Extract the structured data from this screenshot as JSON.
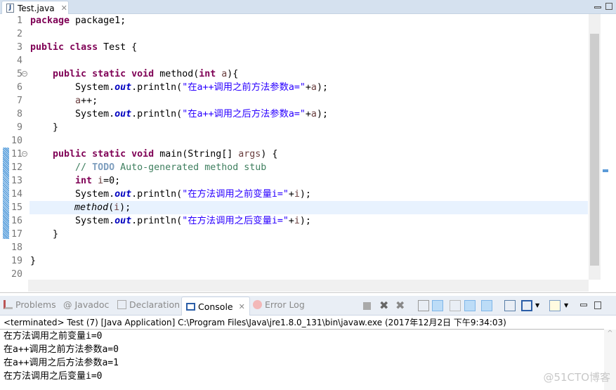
{
  "editor_tab": {
    "label": "Test.java",
    "icon": "java-file-icon"
  },
  "code_lines": [
    [
      [
        "package",
        "kw"
      ],
      [
        " package1;",
        ""
      ]
    ],
    [],
    [
      [
        "public",
        "kw"
      ],
      [
        " ",
        ""
      ],
      [
        "class",
        "kw"
      ],
      [
        " Test {",
        ""
      ]
    ],
    [],
    [
      [
        "    ",
        ""
      ],
      [
        "public",
        "kw"
      ],
      [
        " ",
        ""
      ],
      [
        "static",
        "kw"
      ],
      [
        " ",
        ""
      ],
      [
        "void",
        "kw"
      ],
      [
        " method(",
        ""
      ],
      [
        "int",
        "kw"
      ],
      [
        " ",
        ""
      ],
      [
        "a",
        "var"
      ],
      [
        "){",
        ""
      ]
    ],
    [
      [
        "        System.",
        ""
      ],
      [
        "out",
        "field"
      ],
      [
        ".println(",
        ""
      ],
      [
        "\"在a++调用之前方法参数a=\"",
        "str"
      ],
      [
        "+",
        ""
      ],
      [
        "a",
        "var"
      ],
      [
        ");",
        ""
      ]
    ],
    [
      [
        "        ",
        ""
      ],
      [
        "a",
        "var"
      ],
      [
        "++;",
        ""
      ]
    ],
    [
      [
        "        System.",
        ""
      ],
      [
        "out",
        "field"
      ],
      [
        ".println(",
        ""
      ],
      [
        "\"在a++调用之后方法参数a=\"",
        "str"
      ],
      [
        "+",
        ""
      ],
      [
        "a",
        "var"
      ],
      [
        ");",
        ""
      ]
    ],
    [
      [
        "    }",
        ""
      ]
    ],
    [],
    [
      [
        "    ",
        ""
      ],
      [
        "public",
        "kw"
      ],
      [
        " ",
        ""
      ],
      [
        "static",
        "kw"
      ],
      [
        " ",
        ""
      ],
      [
        "void",
        "kw"
      ],
      [
        " main(String[] ",
        ""
      ],
      [
        "args",
        "var"
      ],
      [
        ") {",
        ""
      ]
    ],
    [
      [
        "        ",
        ""
      ],
      [
        "// ",
        "cm"
      ],
      [
        "TODO",
        "todo"
      ],
      [
        " Auto-generated method stub",
        "cm"
      ]
    ],
    [
      [
        "        ",
        ""
      ],
      [
        "int",
        "kw"
      ],
      [
        " ",
        ""
      ],
      [
        "i",
        "var"
      ],
      [
        "=0;",
        ""
      ]
    ],
    [
      [
        "        System.",
        ""
      ],
      [
        "out",
        "field"
      ],
      [
        ".println(",
        ""
      ],
      [
        "\"在方法调用之前变量i=\"",
        "str"
      ],
      [
        "+",
        ""
      ],
      [
        "i",
        "var"
      ],
      [
        ");",
        ""
      ]
    ],
    [
      [
        "        ",
        ""
      ],
      [
        "method",
        "it"
      ],
      [
        "(",
        ""
      ],
      [
        "i",
        "var"
      ],
      [
        ");",
        ""
      ]
    ],
    [
      [
        "        System.",
        ""
      ],
      [
        "out",
        "field"
      ],
      [
        ".println(",
        ""
      ],
      [
        "\"在方法调用之后变量i=\"",
        "str"
      ],
      [
        "+",
        ""
      ],
      [
        "i",
        "var"
      ],
      [
        ");",
        ""
      ]
    ],
    [
      [
        "    }",
        ""
      ]
    ],
    [],
    [
      [
        "}",
        ""
      ]
    ],
    []
  ],
  "current_line": 15,
  "fold_lines": [
    5,
    11
  ],
  "panel": {
    "tabs": [
      {
        "label": "Problems",
        "icon": "problems-icon",
        "active": false
      },
      {
        "label": "Javadoc",
        "icon": "at-icon",
        "active": false
      },
      {
        "label": "Declaration",
        "icon": "declaration-icon",
        "active": false
      },
      {
        "label": "Console",
        "icon": "console-icon",
        "active": true
      },
      {
        "label": "Error Log",
        "icon": "error-log-icon",
        "active": false
      }
    ],
    "header": "<terminated> Test (7) [Java Application] C:\\Program Files\\Java\\jre1.8.0_131\\bin\\javaw.exe (2017年12月2日 下午9:34:03)",
    "output": [
      "在方法调用之前变量i=0",
      "在a++调用之前方法参数a=0",
      "在a++调用之后方法参数a=1",
      "在方法调用之后变量i=0"
    ]
  },
  "watermark": "@51CTO博客",
  "colors": {
    "keyword": "#7f0055",
    "string": "#2a00ff",
    "field": "#0000c0",
    "comment": "#3f7f5f",
    "current_line": "#e8f2fe"
  }
}
